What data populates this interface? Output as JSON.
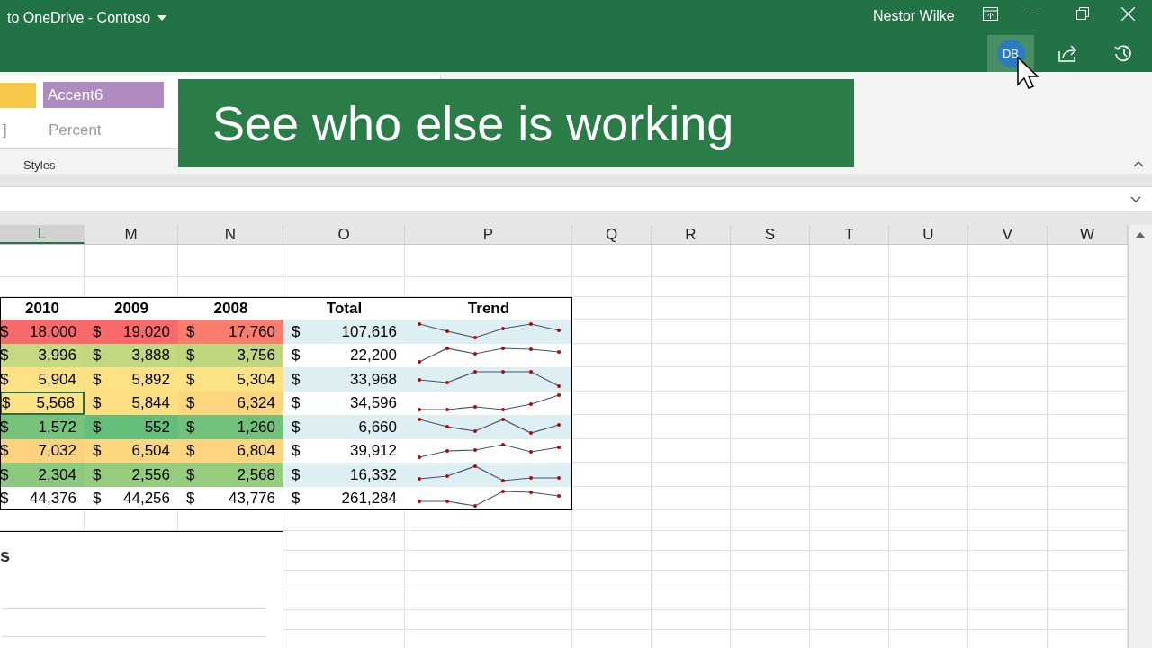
{
  "title_bar": {
    "title": "to OneDrive - Contoso",
    "user": "Nestor Wilke"
  },
  "collaborator": {
    "initials": "DB"
  },
  "ribbon": {
    "swatches": [
      {
        "color": "#f7c94b"
      }
    ],
    "cell_styles": [
      {
        "label": "Accent6",
        "color": "#b08bc2"
      }
    ],
    "format_labels": [
      "]",
      "Percent"
    ],
    "group_label": "Styles"
  },
  "banner": {
    "text": "See who else is working"
  },
  "columns": [
    {
      "label": "L",
      "selected": true
    },
    {
      "label": "M",
      "selected": false
    },
    {
      "label": "N",
      "selected": false
    },
    {
      "label": "O",
      "selected": false
    },
    {
      "label": "P",
      "selected": false
    },
    {
      "label": "Q",
      "selected": false
    },
    {
      "label": "R",
      "selected": false
    },
    {
      "label": "S",
      "selected": false
    },
    {
      "label": "T",
      "selected": false
    },
    {
      "label": "U",
      "selected": false
    },
    {
      "label": "V",
      "selected": false
    },
    {
      "label": "W",
      "selected": false
    }
  ],
  "table": {
    "headers": [
      "2010",
      "2009",
      "2008",
      "Total",
      "Trend"
    ],
    "rows": [
      {
        "banded": true,
        "cells": [
          {
            "symbol": "$",
            "value": "18,000",
            "color": "#f8696b",
            "selected": false
          },
          {
            "symbol": "$",
            "value": "19,020",
            "color": "#f8696b",
            "selected": false
          },
          {
            "symbol": "$",
            "value": "17,760",
            "color": "#f97d6e",
            "selected": false
          }
        ],
        "total": {
          "symbol": "$",
          "value": "107,616"
        }
      },
      {
        "banded": false,
        "cells": [
          {
            "symbol": "$",
            "value": "3,996",
            "color": "#c4d980",
            "selected": false
          },
          {
            "symbol": "$",
            "value": "3,888",
            "color": "#c2d880",
            "selected": false
          },
          {
            "symbol": "$",
            "value": "3,756",
            "color": "#bfd67f",
            "selected": false
          }
        ],
        "total": {
          "symbol": "$",
          "value": "22,200"
        }
      },
      {
        "banded": true,
        "cells": [
          {
            "symbol": "$",
            "value": "5,904",
            "color": "#fee182",
            "selected": false
          },
          {
            "symbol": "$",
            "value": "5,892",
            "color": "#fee182",
            "selected": false
          },
          {
            "symbol": "$",
            "value": "5,304",
            "color": "#fbe383",
            "selected": false
          }
        ],
        "total": {
          "symbol": "$",
          "value": "33,968"
        }
      },
      {
        "banded": false,
        "cells": [
          {
            "symbol": "$",
            "value": "5,568",
            "color": "#fee283",
            "selected": true
          },
          {
            "symbol": "$",
            "value": "5,844",
            "color": "#fedf82",
            "selected": false
          },
          {
            "symbol": "$",
            "value": "6,324",
            "color": "#fdd680",
            "selected": false
          }
        ],
        "total": {
          "symbol": "$",
          "value": "34,596"
        }
      },
      {
        "banded": true,
        "cells": [
          {
            "symbol": "$",
            "value": "1,572",
            "color": "#78c37c",
            "selected": false
          },
          {
            "symbol": "$",
            "value": "552",
            "color": "#63be7b",
            "selected": false
          },
          {
            "symbol": "$",
            "value": "1,260",
            "color": "#71c17c",
            "selected": false
          }
        ],
        "total": {
          "symbol": "$",
          "value": "6,660"
        }
      },
      {
        "banded": false,
        "cells": [
          {
            "symbol": "$",
            "value": "7,032",
            "color": "#fdd27f",
            "selected": false
          },
          {
            "symbol": "$",
            "value": "6,504",
            "color": "#fdd680",
            "selected": false
          },
          {
            "symbol": "$",
            "value": "6,804",
            "color": "#fdd47f",
            "selected": false
          }
        ],
        "total": {
          "symbol": "$",
          "value": "39,912"
        }
      },
      {
        "banded": true,
        "cells": [
          {
            "symbol": "$",
            "value": "2,304",
            "color": "#8ac97e",
            "selected": false
          },
          {
            "symbol": "$",
            "value": "2,556",
            "color": "#96cc7e",
            "selected": false
          },
          {
            "symbol": "$",
            "value": "2,568",
            "color": "#96cc7e",
            "selected": false
          }
        ],
        "total": {
          "symbol": "$",
          "value": "16,332"
        }
      },
      {
        "banded": false,
        "cells": [
          {
            "symbol": "$",
            "value": "44,376",
            "color": "#ffffff",
            "selected": false
          },
          {
            "symbol": "$",
            "value": "44,256",
            "color": "#ffffff",
            "selected": false
          },
          {
            "symbol": "$",
            "value": "43,776",
            "color": "#ffffff",
            "selected": false
          }
        ],
        "total": {
          "symbol": "$",
          "value": "261,284"
        }
      }
    ]
  },
  "chart_panel": {
    "title": "s"
  }
}
